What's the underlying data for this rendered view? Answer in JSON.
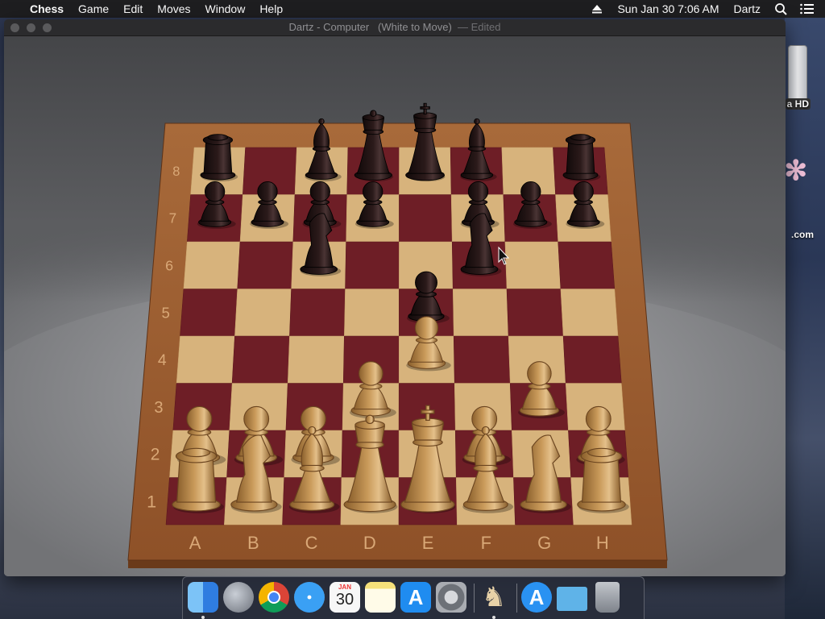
{
  "menubar": {
    "apple": "",
    "app_name": "Chess",
    "items": [
      "Game",
      "Edit",
      "Moves",
      "Window",
      "Help"
    ],
    "datetime": "Sun Jan 30  7:06 AM",
    "user": "Dartz"
  },
  "window": {
    "title_main": "Dartz - Computer",
    "title_status": "(White to Move)",
    "title_edited": "— Edited"
  },
  "desktop": {
    "label_hd": "a HD",
    "label_com": ".com"
  },
  "board": {
    "files": [
      "A",
      "B",
      "C",
      "D",
      "E",
      "F",
      "G",
      "H"
    ],
    "ranks": [
      "1",
      "2",
      "3",
      "4",
      "5",
      "6",
      "7",
      "8"
    ],
    "pieces": [
      {
        "square": "a8",
        "type": "rook",
        "color": "black"
      },
      {
        "square": "c8",
        "type": "bishop",
        "color": "black"
      },
      {
        "square": "d8",
        "type": "queen",
        "color": "black"
      },
      {
        "square": "e8",
        "type": "king",
        "color": "black"
      },
      {
        "square": "f8",
        "type": "bishop",
        "color": "black"
      },
      {
        "square": "h8",
        "type": "rook",
        "color": "black"
      },
      {
        "square": "a7",
        "type": "pawn",
        "color": "black"
      },
      {
        "square": "b7",
        "type": "pawn",
        "color": "black"
      },
      {
        "square": "c7",
        "type": "pawn",
        "color": "black"
      },
      {
        "square": "d7",
        "type": "pawn",
        "color": "black"
      },
      {
        "square": "f7",
        "type": "pawn",
        "color": "black"
      },
      {
        "square": "g7",
        "type": "pawn",
        "color": "black"
      },
      {
        "square": "h7",
        "type": "pawn",
        "color": "black"
      },
      {
        "square": "c6",
        "type": "knight",
        "color": "black"
      },
      {
        "square": "f6",
        "type": "knight",
        "color": "black"
      },
      {
        "square": "e5",
        "type": "pawn",
        "color": "black"
      },
      {
        "square": "e4",
        "type": "pawn",
        "color": "white"
      },
      {
        "square": "d3",
        "type": "pawn",
        "color": "white"
      },
      {
        "square": "g3",
        "type": "pawn",
        "color": "white"
      },
      {
        "square": "a2",
        "type": "pawn",
        "color": "white"
      },
      {
        "square": "b2",
        "type": "pawn",
        "color": "white"
      },
      {
        "square": "c2",
        "type": "pawn",
        "color": "white"
      },
      {
        "square": "f2",
        "type": "pawn",
        "color": "white"
      },
      {
        "square": "h2",
        "type": "pawn",
        "color": "white"
      },
      {
        "square": "a1",
        "type": "rook",
        "color": "white"
      },
      {
        "square": "b1",
        "type": "knight",
        "color": "white"
      },
      {
        "square": "c1",
        "type": "bishop",
        "color": "white"
      },
      {
        "square": "d1",
        "type": "queen",
        "color": "white"
      },
      {
        "square": "e1",
        "type": "king",
        "color": "white"
      },
      {
        "square": "f1",
        "type": "bishop",
        "color": "white"
      },
      {
        "square": "g1",
        "type": "knight",
        "color": "white"
      },
      {
        "square": "h1",
        "type": "rook",
        "color": "white"
      }
    ]
  },
  "colors": {
    "light_square": "#d7b37c",
    "dark_square": "#6e1e26",
    "frame": "#9b5a2e",
    "white_piece": "#c99a5a",
    "black_piece": "#2b1a1a"
  },
  "dock": {
    "apps": [
      {
        "name": "finder-icon",
        "color": "#3c8ff0",
        "running": true
      },
      {
        "name": "launchpad-icon",
        "color": "#8a8f99",
        "running": false
      },
      {
        "name": "chrome-icon",
        "color": "#e8e8e8",
        "running": false
      },
      {
        "name": "safari-icon",
        "color": "#2f8de8",
        "running": false
      },
      {
        "name": "calendar-icon",
        "color": "#f7f7f7",
        "running": false,
        "month": "JAN",
        "day": "30"
      },
      {
        "name": "notes-icon",
        "color": "#f5e07a",
        "running": false
      },
      {
        "name": "app-store-icon",
        "color": "#1f8cf0",
        "running": false
      },
      {
        "name": "system-preferences-icon",
        "color": "#8d9097",
        "running": false
      },
      {
        "name": "chess-icon",
        "color": "#b08a58",
        "running": true
      },
      {
        "name": "app-store-downloads-icon",
        "color": "#2a92f2",
        "running": false
      },
      {
        "name": "downloads-folder-icon",
        "color": "#5fb3e8",
        "running": false
      },
      {
        "name": "trash-icon",
        "color": "#9aa0a8",
        "running": false
      }
    ]
  }
}
